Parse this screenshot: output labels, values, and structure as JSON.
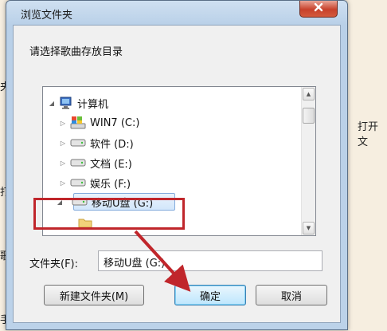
{
  "background": {
    "fragments": [
      "夹中",
      "打开文",
      "打下",
      "歌手",
      "手"
    ]
  },
  "dialog": {
    "title": "浏览文件夹",
    "prompt": "请选择歌曲存放目录",
    "tree": {
      "root": "计算机",
      "items": [
        {
          "label": "WIN7 (C:)"
        },
        {
          "label": "软件 (D:)"
        },
        {
          "label": "文档 (E:)"
        },
        {
          "label": "娱乐 (F:)"
        },
        {
          "label": "移动U盘 (G:)"
        }
      ]
    },
    "folder_label": "文件夹(F):",
    "folder_value": "移动U盘 (G:)",
    "buttons": {
      "new_folder": "新建文件夹(M)",
      "ok": "确定",
      "cancel": "取消"
    }
  },
  "colors": {
    "annotation": "#c0262b",
    "selection": "#d2e6fb"
  }
}
